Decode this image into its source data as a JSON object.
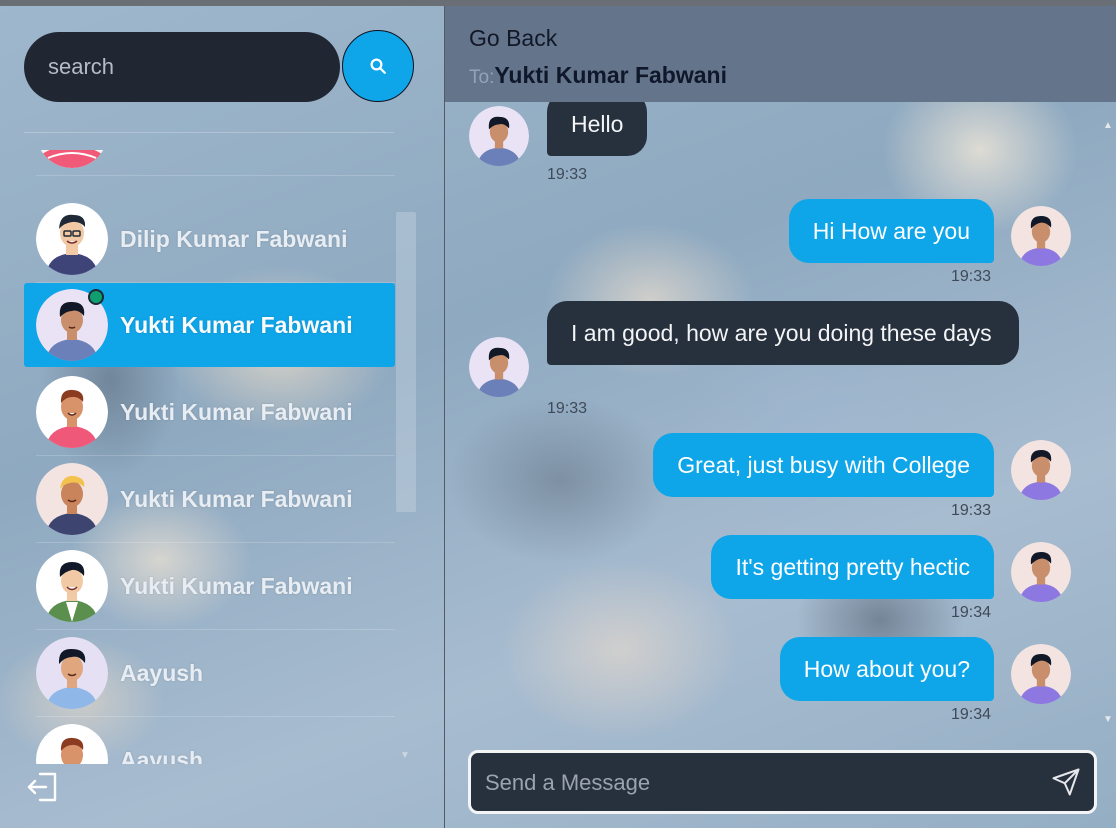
{
  "search": {
    "placeholder": "search"
  },
  "contacts": [
    {
      "name": ""
    },
    {
      "name": "Dilip Kumar Fabwani"
    },
    {
      "name": "Yukti Kumar Fabwani",
      "active": true,
      "online": true
    },
    {
      "name": "Yukti Kumar Fabwani"
    },
    {
      "name": "Yukti Kumar Fabwani"
    },
    {
      "name": "Yukti Kumar Fabwani"
    },
    {
      "name": "Aayush"
    },
    {
      "name": "Aayush"
    }
  ],
  "header": {
    "back_label": "Go Back",
    "to_label": "To:",
    "recipient": "Yukti Kumar Fabwani"
  },
  "messages": [
    {
      "direction": "in",
      "text": "Hello",
      "time": "19:33"
    },
    {
      "direction": "out",
      "text": "Hi How are you",
      "time": "19:33"
    },
    {
      "direction": "in",
      "text": "I am good, how are you doing these days",
      "time": "19:33"
    },
    {
      "direction": "out",
      "text": "Great, just busy with College",
      "time": "19:33"
    },
    {
      "direction": "out",
      "text": "It's getting pretty hectic",
      "time": "19:34"
    },
    {
      "direction": "out",
      "text": "How about you?",
      "time": "19:34"
    }
  ],
  "composer": {
    "placeholder": "Send a Message"
  },
  "colors": {
    "accent": "#0ea5e9",
    "incoming_bubble": "#27303d",
    "header": "#64748b",
    "online": "#0f9f6e"
  },
  "icons": {
    "search": "search-icon",
    "send": "send-icon",
    "logout": "logout-icon"
  }
}
